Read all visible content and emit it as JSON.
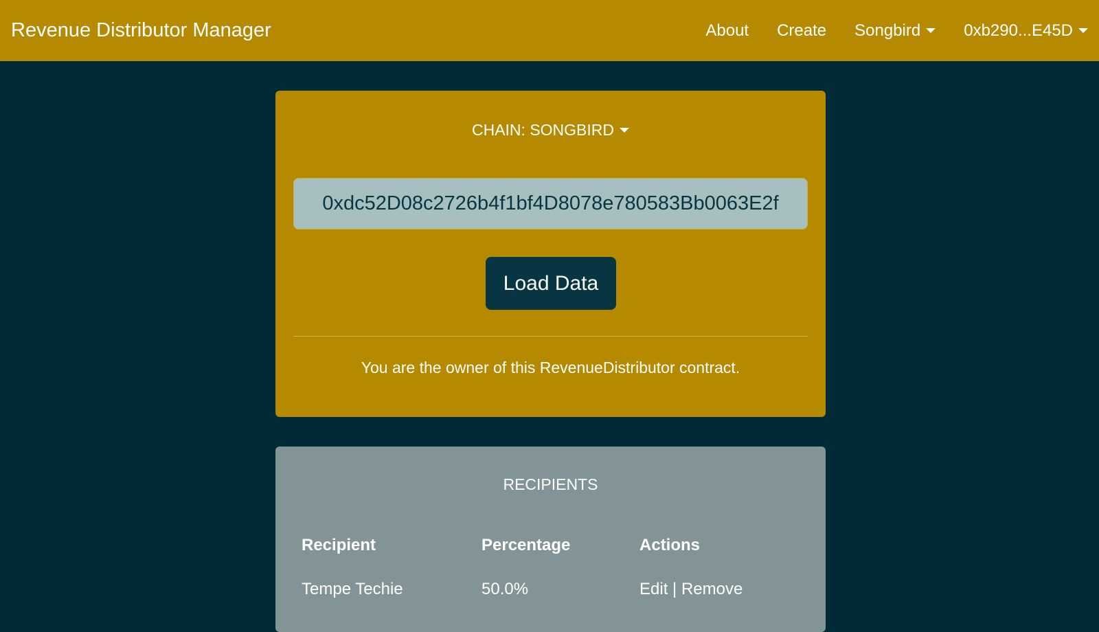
{
  "navbar": {
    "brand": "Revenue Distributor Manager",
    "about": "About",
    "create": "Create",
    "network": "Songbird",
    "account": "0xb290...E45D"
  },
  "contract_card": {
    "chain_label": "CHAIN: SONGBIRD",
    "address_value": "0xdc52D08c2726b4f1bf4D8078e780583Bb0063E2f",
    "load_button": "Load Data",
    "owner_note": "You are the owner of this RevenueDistributor contract."
  },
  "recipients": {
    "title": "RECIPIENTS",
    "headers": {
      "recipient": "Recipient",
      "percentage": "Percentage",
      "actions": "Actions"
    },
    "rows": [
      {
        "recipient": "Tempe Techie",
        "percentage": "50.0%",
        "edit": "Edit",
        "separator": "|",
        "remove": "Remove"
      }
    ]
  },
  "colors": {
    "accent": "#b58900",
    "background": "#002b36",
    "button": "#073642",
    "card_secondary": "#839496"
  }
}
